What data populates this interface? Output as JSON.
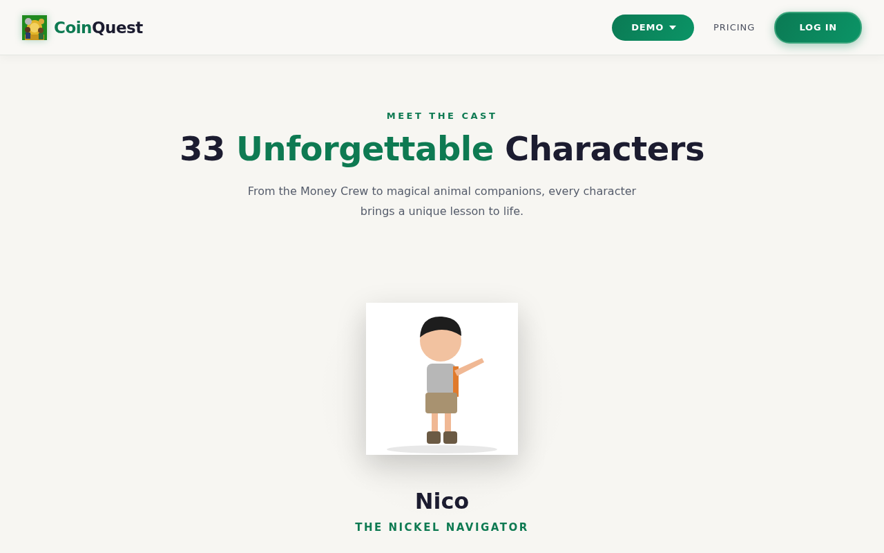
{
  "header": {
    "logo": {
      "kind": "picture",
      "name_parts": [
        {
          "text": "Coin",
          "accent": true
        },
        {
          "text": "Quest",
          "accent": false
        }
      ]
    },
    "nav": [
      {
        "kind": "dropdown",
        "label": "DEMO"
      },
      {
        "kind": "link",
        "label": "PRICING"
      },
      {
        "kind": "cta",
        "label": "LOG IN"
      }
    ]
  },
  "hero": {
    "eyebrow": "MEET THE CAST",
    "title_parts": [
      {
        "text": "33 ",
        "accent": false
      },
      {
        "text": "Unforgettable",
        "accent": true
      },
      {
        "text": " Characters",
        "accent": false
      }
    ],
    "subtitle": "From the Money Crew to magical animal companions, every character brings a unique lesson to life."
  },
  "character": {
    "name": "Nico",
    "role": "THE NICKEL NAVIGATOR"
  }
}
